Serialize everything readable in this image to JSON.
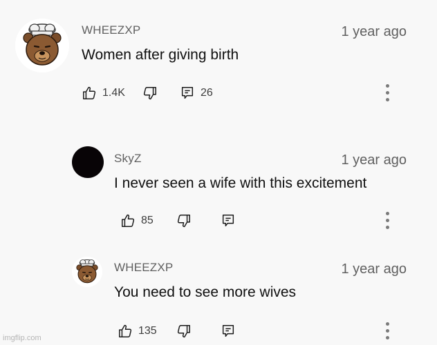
{
  "comments": [
    {
      "author": "WHEEZXP",
      "time": "1 year ago",
      "text": "Women after giving birth",
      "likes": "1.4K",
      "replies": "26",
      "avatar_icon": "chef-bear-icon"
    },
    {
      "author": "SkyZ",
      "time": "1 year ago",
      "text": "I never seen a wife with this excitement",
      "likes": "85",
      "replies": "",
      "avatar_icon": "dark-avatar"
    },
    {
      "author": "WHEEZXP",
      "time": "1 year ago",
      "text": "You need to see more wives",
      "likes": "135",
      "replies": "",
      "avatar_icon": "chef-bear-icon"
    }
  ],
  "icons": {
    "like": "thumbs-up-icon",
    "dislike": "thumbs-down-icon",
    "reply": "reply-icon",
    "more": "more-vert-icon"
  },
  "watermark": "imgflip.com"
}
